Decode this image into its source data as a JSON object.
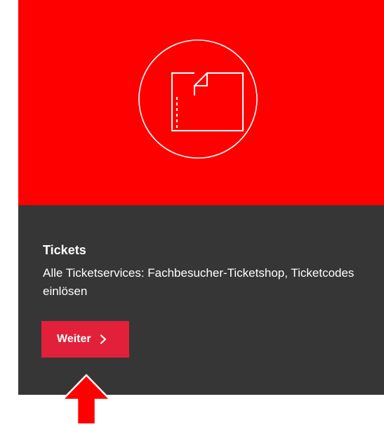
{
  "tile": {
    "icon": "ticket-icon",
    "background_color": "#ff0000",
    "card_color": "#363636",
    "title": "Tickets",
    "description": "Alle Ticketservices: Fachbesucher-Ticketshop, Ticketcodes einlösen",
    "button": {
      "label": "Weiter",
      "icon": "chevron-right-icon",
      "color": "#e2203a"
    }
  },
  "annotation": {
    "icon": "up-arrow-pointer",
    "color": "#ff0000"
  }
}
